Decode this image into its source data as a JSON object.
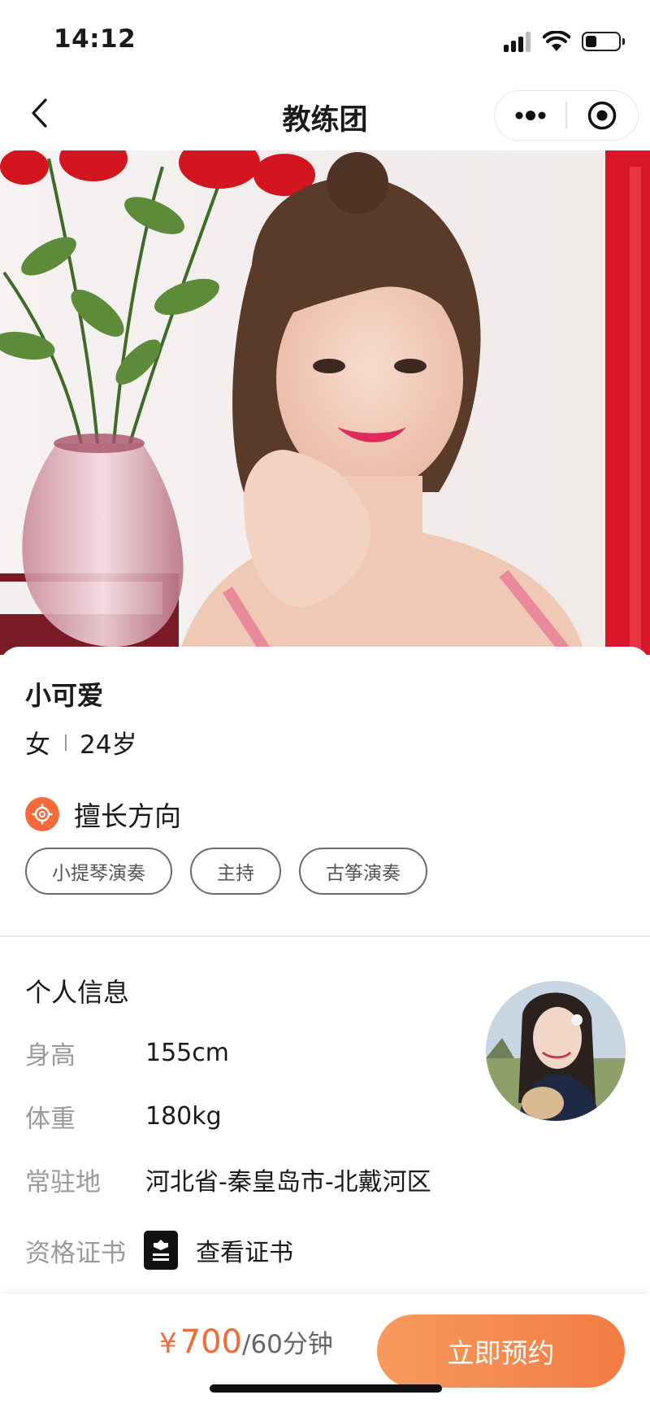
{
  "status_bar": {
    "time": "14:12",
    "battery_level": 0.35
  },
  "nav": {
    "title": "教练团",
    "back_icon": "chevron-left-icon",
    "more_icon": "more-dots-icon",
    "close_icon": "target-close-icon"
  },
  "profile": {
    "name": "小可爱",
    "gender": "女",
    "age": "24岁",
    "specialty_title": "擅长方向",
    "specialty_icon": "gear-badge-icon",
    "tags": [
      "小提琴演奏",
      "主持",
      "古筝演奏"
    ]
  },
  "info": {
    "title": "个人信息",
    "rows": [
      {
        "label": "身高",
        "value": "155cm"
      },
      {
        "label": "体重",
        "value": "180kg"
      },
      {
        "label": "常驻地",
        "value": "河北省-秦皇岛市-北戴河区"
      },
      {
        "label": "资格证书",
        "value": "查看证书"
      }
    ],
    "cert_icon": "certificate-icon"
  },
  "bottom": {
    "currency": "¥",
    "price": "700",
    "unit": "/60分钟",
    "book_label": "立即预约"
  },
  "colors": {
    "accent": "#f27c43",
    "price": "#f26a38"
  }
}
